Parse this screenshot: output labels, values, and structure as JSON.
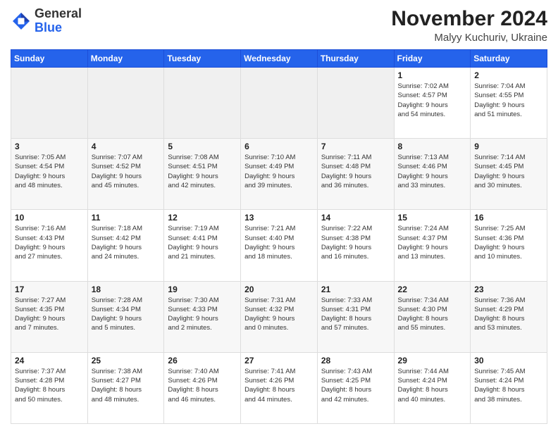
{
  "header": {
    "logo_general": "General",
    "logo_blue": "Blue",
    "month_title": "November 2024",
    "location": "Malyy Kuchuriv, Ukraine"
  },
  "days_of_week": [
    "Sunday",
    "Monday",
    "Tuesday",
    "Wednesday",
    "Thursday",
    "Friday",
    "Saturday"
  ],
  "weeks": [
    [
      {
        "day": "",
        "info": ""
      },
      {
        "day": "",
        "info": ""
      },
      {
        "day": "",
        "info": ""
      },
      {
        "day": "",
        "info": ""
      },
      {
        "day": "",
        "info": ""
      },
      {
        "day": "1",
        "info": "Sunrise: 7:02 AM\nSunset: 4:57 PM\nDaylight: 9 hours\nand 54 minutes."
      },
      {
        "day": "2",
        "info": "Sunrise: 7:04 AM\nSunset: 4:55 PM\nDaylight: 9 hours\nand 51 minutes."
      }
    ],
    [
      {
        "day": "3",
        "info": "Sunrise: 7:05 AM\nSunset: 4:54 PM\nDaylight: 9 hours\nand 48 minutes."
      },
      {
        "day": "4",
        "info": "Sunrise: 7:07 AM\nSunset: 4:52 PM\nDaylight: 9 hours\nand 45 minutes."
      },
      {
        "day": "5",
        "info": "Sunrise: 7:08 AM\nSunset: 4:51 PM\nDaylight: 9 hours\nand 42 minutes."
      },
      {
        "day": "6",
        "info": "Sunrise: 7:10 AM\nSunset: 4:49 PM\nDaylight: 9 hours\nand 39 minutes."
      },
      {
        "day": "7",
        "info": "Sunrise: 7:11 AM\nSunset: 4:48 PM\nDaylight: 9 hours\nand 36 minutes."
      },
      {
        "day": "8",
        "info": "Sunrise: 7:13 AM\nSunset: 4:46 PM\nDaylight: 9 hours\nand 33 minutes."
      },
      {
        "day": "9",
        "info": "Sunrise: 7:14 AM\nSunset: 4:45 PM\nDaylight: 9 hours\nand 30 minutes."
      }
    ],
    [
      {
        "day": "10",
        "info": "Sunrise: 7:16 AM\nSunset: 4:43 PM\nDaylight: 9 hours\nand 27 minutes."
      },
      {
        "day": "11",
        "info": "Sunrise: 7:18 AM\nSunset: 4:42 PM\nDaylight: 9 hours\nand 24 minutes."
      },
      {
        "day": "12",
        "info": "Sunrise: 7:19 AM\nSunset: 4:41 PM\nDaylight: 9 hours\nand 21 minutes."
      },
      {
        "day": "13",
        "info": "Sunrise: 7:21 AM\nSunset: 4:40 PM\nDaylight: 9 hours\nand 18 minutes."
      },
      {
        "day": "14",
        "info": "Sunrise: 7:22 AM\nSunset: 4:38 PM\nDaylight: 9 hours\nand 16 minutes."
      },
      {
        "day": "15",
        "info": "Sunrise: 7:24 AM\nSunset: 4:37 PM\nDaylight: 9 hours\nand 13 minutes."
      },
      {
        "day": "16",
        "info": "Sunrise: 7:25 AM\nSunset: 4:36 PM\nDaylight: 9 hours\nand 10 minutes."
      }
    ],
    [
      {
        "day": "17",
        "info": "Sunrise: 7:27 AM\nSunset: 4:35 PM\nDaylight: 9 hours\nand 7 minutes."
      },
      {
        "day": "18",
        "info": "Sunrise: 7:28 AM\nSunset: 4:34 PM\nDaylight: 9 hours\nand 5 minutes."
      },
      {
        "day": "19",
        "info": "Sunrise: 7:30 AM\nSunset: 4:33 PM\nDaylight: 9 hours\nand 2 minutes."
      },
      {
        "day": "20",
        "info": "Sunrise: 7:31 AM\nSunset: 4:32 PM\nDaylight: 9 hours\nand 0 minutes."
      },
      {
        "day": "21",
        "info": "Sunrise: 7:33 AM\nSunset: 4:31 PM\nDaylight: 8 hours\nand 57 minutes."
      },
      {
        "day": "22",
        "info": "Sunrise: 7:34 AM\nSunset: 4:30 PM\nDaylight: 8 hours\nand 55 minutes."
      },
      {
        "day": "23",
        "info": "Sunrise: 7:36 AM\nSunset: 4:29 PM\nDaylight: 8 hours\nand 53 minutes."
      }
    ],
    [
      {
        "day": "24",
        "info": "Sunrise: 7:37 AM\nSunset: 4:28 PM\nDaylight: 8 hours\nand 50 minutes."
      },
      {
        "day": "25",
        "info": "Sunrise: 7:38 AM\nSunset: 4:27 PM\nDaylight: 8 hours\nand 48 minutes."
      },
      {
        "day": "26",
        "info": "Sunrise: 7:40 AM\nSunset: 4:26 PM\nDaylight: 8 hours\nand 46 minutes."
      },
      {
        "day": "27",
        "info": "Sunrise: 7:41 AM\nSunset: 4:26 PM\nDaylight: 8 hours\nand 44 minutes."
      },
      {
        "day": "28",
        "info": "Sunrise: 7:43 AM\nSunset: 4:25 PM\nDaylight: 8 hours\nand 42 minutes."
      },
      {
        "day": "29",
        "info": "Sunrise: 7:44 AM\nSunset: 4:24 PM\nDaylight: 8 hours\nand 40 minutes."
      },
      {
        "day": "30",
        "info": "Sunrise: 7:45 AM\nSunset: 4:24 PM\nDaylight: 8 hours\nand 38 minutes."
      }
    ]
  ]
}
